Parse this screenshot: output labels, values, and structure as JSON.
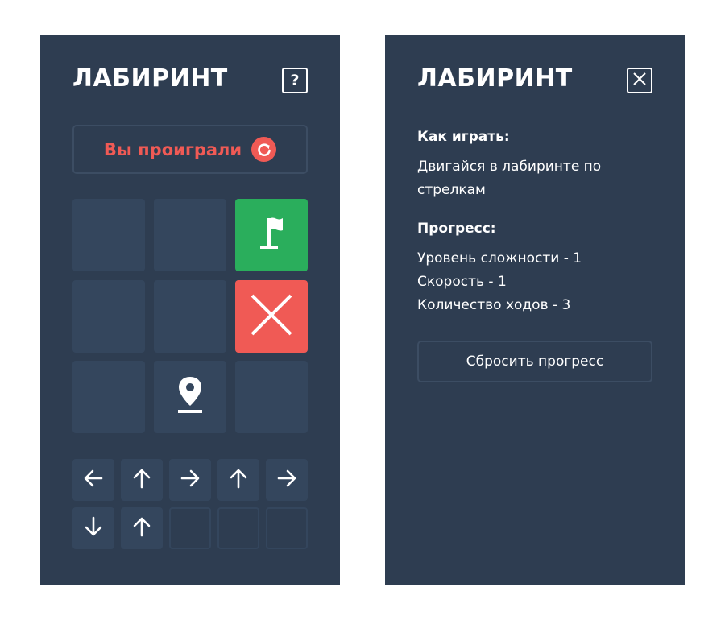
{
  "left_panel": {
    "title": "ЛАБИРИНТ",
    "help_label": "?",
    "status": {
      "text": "Вы проиграли",
      "icon": "retry-icon"
    },
    "maze": {
      "cells": [
        {
          "row": 1,
          "col": 1,
          "type": "empty"
        },
        {
          "row": 1,
          "col": 2,
          "type": "empty"
        },
        {
          "row": 1,
          "col": 3,
          "type": "finish",
          "icon": "flag-icon"
        },
        {
          "row": 2,
          "col": 1,
          "type": "empty"
        },
        {
          "row": 2,
          "col": 2,
          "type": "empty"
        },
        {
          "row": 2,
          "col": 3,
          "type": "fail",
          "icon": "cross-icon"
        },
        {
          "row": 3,
          "col": 1,
          "type": "empty"
        },
        {
          "row": 3,
          "col": 2,
          "type": "start",
          "icon": "location-pin-icon"
        },
        {
          "row": 3,
          "col": 3,
          "type": "empty"
        }
      ]
    },
    "moves": [
      "left",
      "up",
      "right",
      "up",
      "right",
      "down",
      "up",
      "",
      "",
      ""
    ]
  },
  "right_panel": {
    "title": "ЛАБИРИНТ",
    "close_icon": "close-icon",
    "how_to_play": {
      "heading": "Как играть:",
      "text": "Двигайся в лабиринте по стрелкам"
    },
    "progress": {
      "heading": "Прогресс:",
      "lines": [
        "Уровень сложности - 1",
        "Скорость - 1",
        "Количество ходов - 3"
      ]
    },
    "reset_label": "Сбросить прогресс"
  },
  "colors": {
    "panel": "#2e3d51",
    "cell": "#34465d",
    "finish": "#2aae5c",
    "fail": "#f05a55",
    "text": "#ffffff"
  }
}
